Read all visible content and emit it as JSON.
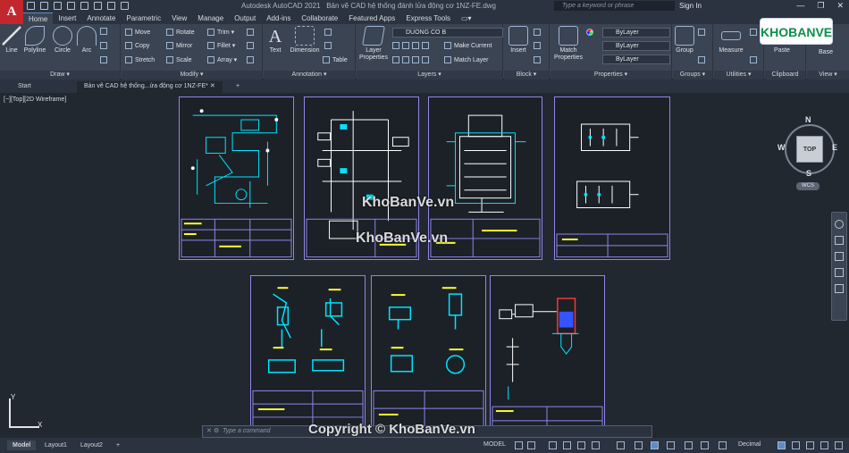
{
  "app": {
    "logo_letter": "A",
    "title": "Autodesk AutoCAD 2021",
    "file_title": "Bản vẽ CAD hệ thống đánh lửa động cơ 1NZ-FE.dwg",
    "search_placeholder": "Type a keyword or phrase",
    "sign_in": "Sign In"
  },
  "ribbon_tabs": [
    "Home",
    "Insert",
    "Annotate",
    "Parametric",
    "View",
    "Manage",
    "Output",
    "Add-ins",
    "Collaborate",
    "Featured Apps",
    "Express Tools"
  ],
  "ribbon": {
    "draw": {
      "label": "Draw ▾",
      "line": "Line",
      "polyline": "Polyline",
      "circle": "Circle",
      "arc": "Arc"
    },
    "modify": {
      "label": "Modify ▾",
      "move": "Move",
      "rotate": "Rotate",
      "trim": "Trim ▾",
      "copy": "Copy",
      "mirror": "Mirror",
      "fillet": "Fillet ▾",
      "stretch": "Stretch",
      "scale": "Scale",
      "array": "Array ▾"
    },
    "annotation": {
      "label": "Annotation ▾",
      "text": "Text",
      "dimension": "Dimension",
      "table": "Table"
    },
    "layers": {
      "label": "Layers ▾",
      "layer_properties": "Layer Properties",
      "current_layer": "DUONG CO B",
      "make_current": "Make Current",
      "match_layer": "Match Layer"
    },
    "block": {
      "label": "Block ▾",
      "insert": "Insert"
    },
    "properties": {
      "label": "Properties ▾",
      "match_properties": "Match Properties",
      "color": "ByLayer",
      "linetype": "ByLayer",
      "lineweight": "ByLayer"
    },
    "groups": {
      "label": "Groups ▾",
      "group": "Group"
    },
    "utilities": {
      "label": "Utilities ▾",
      "measure": "Measure"
    },
    "clipboard": {
      "label": "Clipboard",
      "paste": "Paste"
    },
    "view": {
      "label": "View ▾",
      "base": "Base"
    }
  },
  "doc_tabs": {
    "start": "Start",
    "active": "Bản vẽ CAD hệ thống...ửa động cơ 1NZ-FE*",
    "add": "+"
  },
  "viewport": {
    "label": "[−][Top][2D Wireframe]"
  },
  "viewcube": {
    "north": "N",
    "south": "S",
    "east": "E",
    "west": "W",
    "face": "TOP",
    "wcs": "WCS"
  },
  "ucs": {
    "x": "X",
    "y": "Y"
  },
  "command": {
    "placeholder": "Type a command"
  },
  "layout_tabs": [
    "Model",
    "Layout1",
    "Layout2"
  ],
  "status": {
    "model": "MODEL",
    "units": "Decimal"
  },
  "watermarks": {
    "main": "KhoBanVe.vn",
    "copyright": "Copyright © KhoBanVe.vn",
    "brand": "KHOBANVE"
  },
  "colors": {
    "accent": "#5d8cc9",
    "sheet_border": "#8f86e8",
    "cyan": "#00e5ff",
    "yellow": "#ffff33"
  }
}
